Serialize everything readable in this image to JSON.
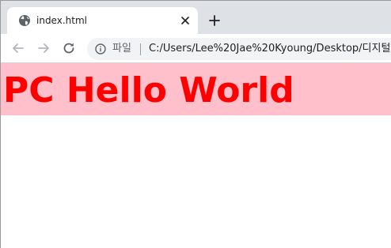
{
  "tab": {
    "title": "index.html",
    "favicon": "globe-icon"
  },
  "toolbar": {
    "back_icon": "back-arrow-icon",
    "forward_icon": "forward-arrow-icon",
    "reload_icon": "reload-icon"
  },
  "omnibox": {
    "info_icon": "info-icon",
    "scheme_label": "파일",
    "url": "C:/Users/Lee%20Jae%20Kyoung/Desktop/디지털"
  },
  "page": {
    "heading": "PC Hello World",
    "heading_color": "#ff0000",
    "banner_color": "#ffc0cb"
  }
}
